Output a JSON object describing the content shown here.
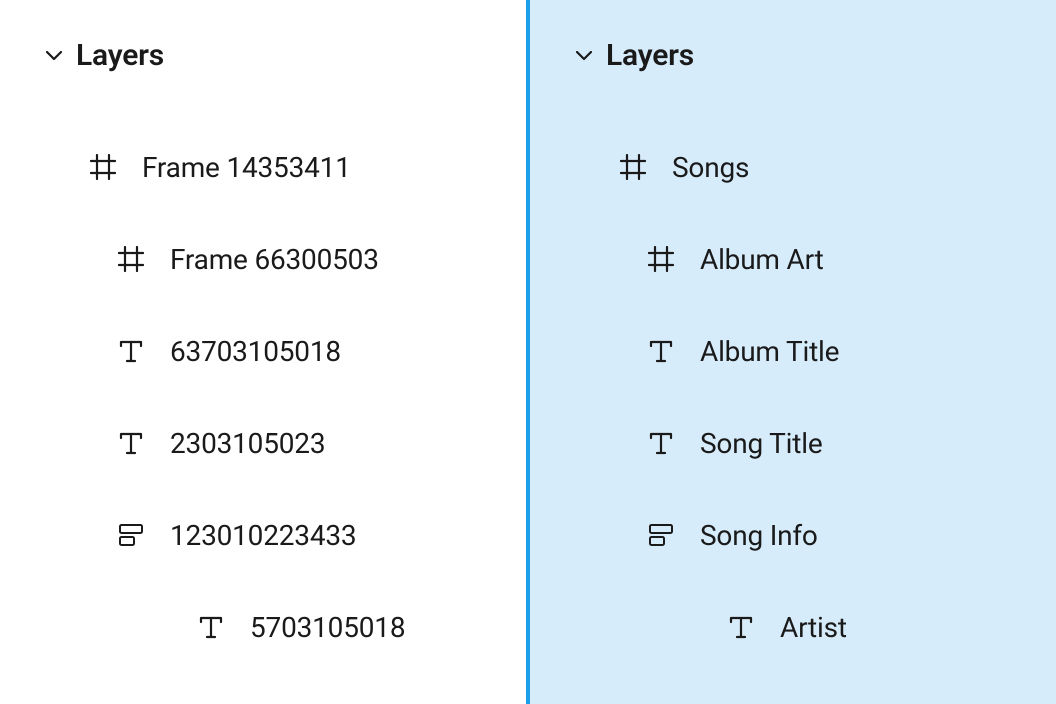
{
  "left_panel": {
    "title": "Layers",
    "items": [
      {
        "icon": "frame",
        "label": "Frame 14353411",
        "indent": 0
      },
      {
        "icon": "frame",
        "label": "Frame 66300503",
        "indent": 1
      },
      {
        "icon": "text",
        "label": "63703105018",
        "indent": 1
      },
      {
        "icon": "text",
        "label": "2303105023",
        "indent": 1
      },
      {
        "icon": "group",
        "label": "123010223433",
        "indent": 1
      },
      {
        "icon": "text",
        "label": "5703105018",
        "indent": 2
      }
    ]
  },
  "right_panel": {
    "title": "Layers",
    "items": [
      {
        "icon": "frame",
        "label": "Songs",
        "indent": 0
      },
      {
        "icon": "frame",
        "label": "Album Art",
        "indent": 1
      },
      {
        "icon": "text",
        "label": "Album Title",
        "indent": 1
      },
      {
        "icon": "text",
        "label": "Song Title",
        "indent": 1
      },
      {
        "icon": "group",
        "label": "Song Info",
        "indent": 1
      },
      {
        "icon": "text",
        "label": "Artist",
        "indent": 2
      }
    ]
  }
}
